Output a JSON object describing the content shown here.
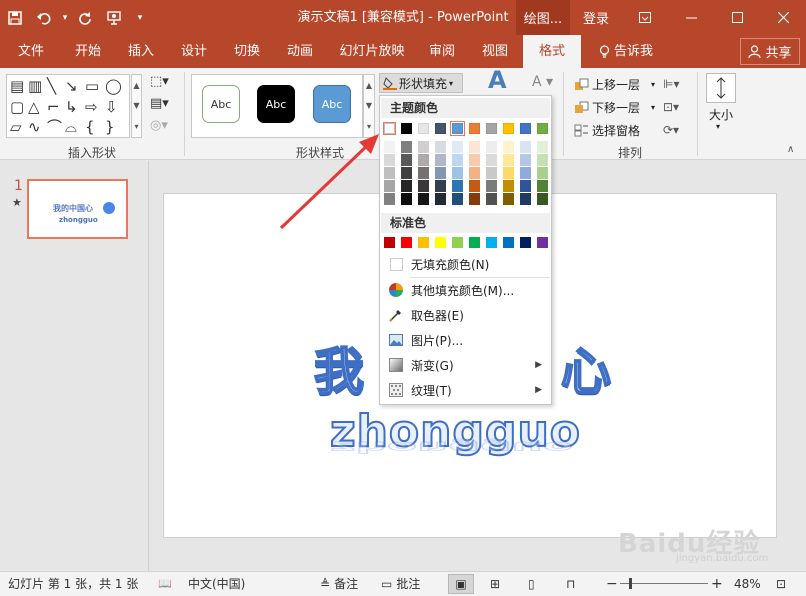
{
  "title_bar": {
    "title": "演示文稿1 [兼容模式] - PowerPoint",
    "context_tab": "绘图...",
    "login": "登录",
    "qat_icons": [
      "save-icon",
      "undo-icon",
      "redo-icon",
      "present-icon",
      "customize-icon"
    ],
    "window_buttons": [
      "ribbon-display-icon",
      "minimize-icon",
      "maximize-icon",
      "close-icon"
    ]
  },
  "tabs": [
    "文件",
    "开始",
    "插入",
    "设计",
    "切换",
    "动画",
    "幻灯片放映",
    "审阅",
    "视图",
    "格式"
  ],
  "active_tab": "格式",
  "tell_me": "告诉我",
  "share": "共享",
  "ribbon": {
    "insert_shapes_label": "插入形状",
    "shape_styles_label": "形状样式",
    "arrange_label": "排列",
    "style_samples": [
      "Abc",
      "Abc",
      "Abc"
    ],
    "shape_fill_button": "形状填充",
    "bring_forward": "上移一层",
    "send_backward": "下移一层",
    "selection_pane": "选择窗格",
    "size": "大小"
  },
  "thumbnail": {
    "number": "1",
    "star": "★",
    "text1": "我的中国心",
    "text2": "zhongguo"
  },
  "slide": {
    "line1_left": "我",
    "line1_right": "心",
    "line2": "zhongguo"
  },
  "fill_menu": {
    "theme_colors_header": "主题颜色",
    "theme_colors_top": [
      "#ffffff",
      "#000000",
      "#e7e6e6",
      "#44546a",
      "#5b9bd5",
      "#ed7d31",
      "#a5a5a5",
      "#ffc000",
      "#4472c4",
      "#70ad47"
    ],
    "theme_shades": [
      [
        "#f2f2f2",
        "#d9d9d9",
        "#bfbfbf",
        "#a6a6a6",
        "#808080"
      ],
      [
        "#7f7f7f",
        "#595959",
        "#404040",
        "#262626",
        "#0d0d0d"
      ],
      [
        "#d0cece",
        "#aeaaaa",
        "#757171",
        "#3a3838",
        "#161616"
      ],
      [
        "#d6dce4",
        "#adb9ca",
        "#8497b0",
        "#333f4f",
        "#222a35"
      ],
      [
        "#deebf7",
        "#bdd7ee",
        "#9dc3e6",
        "#2e75b6",
        "#1f4e79"
      ],
      [
        "#fbe5d6",
        "#f8cbad",
        "#f4b183",
        "#c55a11",
        "#843c0c"
      ],
      [
        "#ededed",
        "#dbdbdb",
        "#c9c9c9",
        "#7b7b7b",
        "#525252"
      ],
      [
        "#fff2cc",
        "#ffe699",
        "#ffd966",
        "#bf9000",
        "#7f6000"
      ],
      [
        "#dae3f3",
        "#b4c7e7",
        "#8faadc",
        "#2f5597",
        "#203864"
      ],
      [
        "#e2f0d9",
        "#c5e0b4",
        "#a9d18e",
        "#548235",
        "#385723"
      ]
    ],
    "standard_colors_header": "标准色",
    "standard_colors": [
      "#c00000",
      "#ff0000",
      "#ffc000",
      "#ffff00",
      "#92d050",
      "#00b050",
      "#00b0f0",
      "#0070c0",
      "#002060",
      "#7030a0"
    ],
    "no_fill": "无填充颜色(N)",
    "more_colors": "其他填充颜色(M)...",
    "eyedropper": "取色器(E)",
    "picture": "图片(P)...",
    "gradient": "渐变(G)",
    "texture": "纹理(T)"
  },
  "status_bar": {
    "slide_info": "幻灯片 第 1 张，共 1 张",
    "language": "中文(中国)",
    "notes": "备注",
    "comments": "批注",
    "zoom_minus": "−",
    "zoom_plus": "+",
    "zoom": "48%"
  },
  "watermark": {
    "brand": "Baidu经验",
    "url": "jingyan.baidu.com"
  }
}
